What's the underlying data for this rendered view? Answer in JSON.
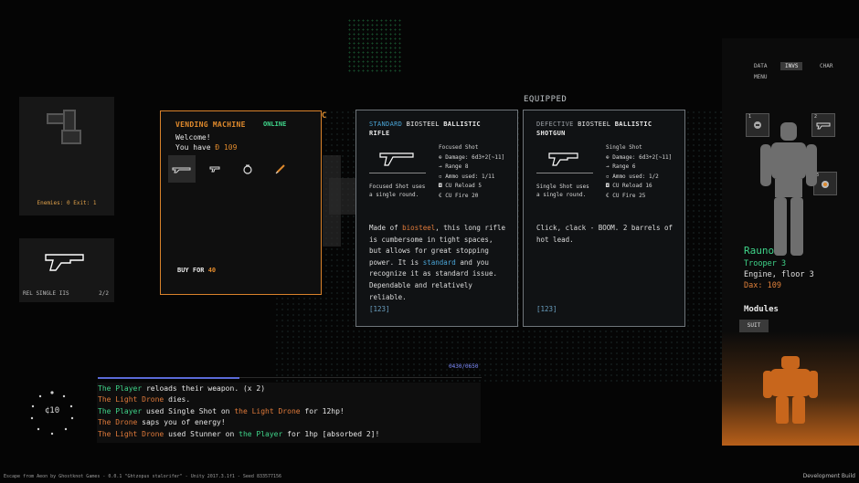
{
  "minimap": {
    "counts": "Enemies: 0 Exit: 1"
  },
  "weapon_slot": {
    "name": "REL SINGLE IIS",
    "ammo": "2/2"
  },
  "vending": {
    "esc": "ESC",
    "title": "VENDING MACHINE",
    "status": "ONLINE",
    "welcome": "Welcome!",
    "have_prefix": "You have ",
    "credits": "Ð 109",
    "buy_prefix": "BUY FOR ",
    "price": "40",
    "items": [
      "rifle-icon",
      "pistol-icon",
      "grenade-icon",
      "syringe-icon"
    ]
  },
  "equipped_label": "EQUIPPED",
  "card_standard": {
    "quality": "STANDARD",
    "material": "BIOSTEEL",
    "category": "BALLISTIC",
    "type": "RIFLE",
    "mode": "Focused Shot uses a single round.",
    "stat_head": "Focused Shot",
    "stats": [
      "⊕ Damage: 6d3+2[~11]",
      "→ Range 8",
      "▫ Ammo used: 1/11",
      "◘ CU Reload 5",
      "€ CU Fire 20"
    ],
    "desc_1": "Made of ",
    "desc_hl1": "biosteel",
    "desc_2": ", this long rifle is cumbersome in tight spaces, but allows for great stopping power. It is ",
    "desc_hl2": "standard",
    "desc_3": " and you recognize it as standard issue. Dependable and relatively reliable.",
    "number": "[123]"
  },
  "card_defective": {
    "quality": "DEFECTIVE",
    "material": "BIOSTEEL",
    "category": "BALLISTIC",
    "type": "SHOTGUN",
    "mode": "Single Shot uses a single round.",
    "stat_head": "Single Shot",
    "stats": [
      "⊕ Damage: 6d3+2[~11]",
      "→ Range 6",
      "▫ Ammo used: 1/2",
      "◘ CU Reload 16",
      "€ CU Fire 25"
    ],
    "desc": "Click, clack - BOOM. 2 barrels of hot lead.",
    "number": "[123]"
  },
  "character": {
    "tabs": [
      "DATA",
      "INVS",
      "CHAR",
      "MENU"
    ],
    "slots": [
      "1",
      "2",
      "3"
    ],
    "name": "Rauno",
    "rank": "Trooper 3",
    "location": "Engine, floor 3",
    "dax": "Dax: 109",
    "modules": "Modules",
    "suit": "SUIT"
  },
  "xp": {
    "text": "0430/0650",
    "progress": 0.37
  },
  "log": {
    "l1a": "The Player",
    "l1b": " reloads their weapon. (x 2)",
    "l2a": "The Light Drone",
    "l2b": " dies.",
    "l3a": "The Player",
    "l3b": " used Single Shot on ",
    "l3c": "the Light Drone",
    "l3d": " for 12hp!",
    "l4a": "The Drone",
    "l4b": " saps you of energy!",
    "l5a": "The Light Drone",
    "l5b": " used Stunner on ",
    "l5c": "the Player",
    "l5d": " for 1hp [absorbed 2]!"
  },
  "gauge": {
    "value": "¢10"
  },
  "footer": "Escape from Aeon by Ghostknot Games - 0.0.1 \"Ghtzopus stalorifer\" - Unity 2017.3.1f1 - Seed 833577156",
  "dev": "Development Build"
}
